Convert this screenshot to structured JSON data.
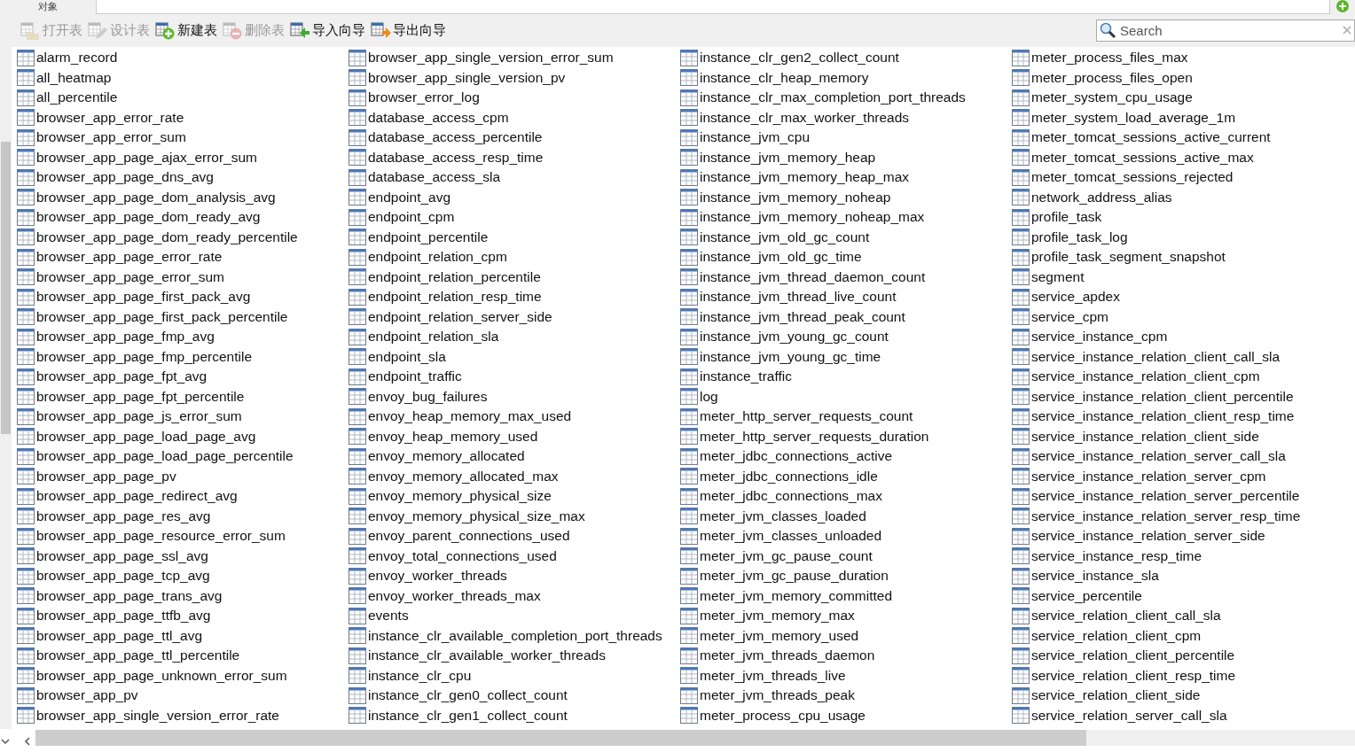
{
  "object_tab": {
    "label": "对象"
  },
  "toolbar": [
    {
      "label": "打开表",
      "kind": "open",
      "disabled": true
    },
    {
      "label": "设计表",
      "kind": "design",
      "disabled": true
    },
    {
      "label": "新建表",
      "kind": "new",
      "disabled": false
    },
    {
      "label": "删除表",
      "kind": "delete",
      "disabled": true
    },
    {
      "label": "导入向导",
      "kind": "import",
      "disabled": false
    },
    {
      "label": "导出向导",
      "kind": "export",
      "disabled": false
    }
  ],
  "search": {
    "placeholder": "Search"
  },
  "tables": [
    "alarm_record",
    "all_heatmap",
    "all_percentile",
    "browser_app_error_rate",
    "browser_app_error_sum",
    "browser_app_page_ajax_error_sum",
    "browser_app_page_dns_avg",
    "browser_app_page_dom_analysis_avg",
    "browser_app_page_dom_ready_avg",
    "browser_app_page_dom_ready_percentile",
    "browser_app_page_error_rate",
    "browser_app_page_error_sum",
    "browser_app_page_first_pack_avg",
    "browser_app_page_first_pack_percentile",
    "browser_app_page_fmp_avg",
    "browser_app_page_fmp_percentile",
    "browser_app_page_fpt_avg",
    "browser_app_page_fpt_percentile",
    "browser_app_page_js_error_sum",
    "browser_app_page_load_page_avg",
    "browser_app_page_load_page_percentile",
    "browser_app_page_pv",
    "browser_app_page_redirect_avg",
    "browser_app_page_res_avg",
    "browser_app_page_resource_error_sum",
    "browser_app_page_ssl_avg",
    "browser_app_page_tcp_avg",
    "browser_app_page_trans_avg",
    "browser_app_page_ttfb_avg",
    "browser_app_page_ttl_avg",
    "browser_app_page_ttl_percentile",
    "browser_app_page_unknown_error_sum",
    "browser_app_pv",
    "browser_app_single_version_error_rate",
    "browser_app_single_version_error_sum",
    "browser_app_single_version_pv",
    "browser_error_log",
    "database_access_cpm",
    "database_access_percentile",
    "database_access_resp_time",
    "database_access_sla",
    "endpoint_avg",
    "endpoint_cpm",
    "endpoint_percentile",
    "endpoint_relation_cpm",
    "endpoint_relation_percentile",
    "endpoint_relation_resp_time",
    "endpoint_relation_server_side",
    "endpoint_relation_sla",
    "endpoint_sla",
    "endpoint_traffic",
    "envoy_bug_failures",
    "envoy_heap_memory_max_used",
    "envoy_heap_memory_used",
    "envoy_memory_allocated",
    "envoy_memory_allocated_max",
    "envoy_memory_physical_size",
    "envoy_memory_physical_size_max",
    "envoy_parent_connections_used",
    "envoy_total_connections_used",
    "envoy_worker_threads",
    "envoy_worker_threads_max",
    "events",
    "instance_clr_available_completion_port_threads",
    "instance_clr_available_worker_threads",
    "instance_clr_cpu",
    "instance_clr_gen0_collect_count",
    "instance_clr_gen1_collect_count",
    "instance_clr_gen2_collect_count",
    "instance_clr_heap_memory",
    "instance_clr_max_completion_port_threads",
    "instance_clr_max_worker_threads",
    "instance_jvm_cpu",
    "instance_jvm_memory_heap",
    "instance_jvm_memory_heap_max",
    "instance_jvm_memory_noheap",
    "instance_jvm_memory_noheap_max",
    "instance_jvm_old_gc_count",
    "instance_jvm_old_gc_time",
    "instance_jvm_thread_daemon_count",
    "instance_jvm_thread_live_count",
    "instance_jvm_thread_peak_count",
    "instance_jvm_young_gc_count",
    "instance_jvm_young_gc_time",
    "instance_traffic",
    "log",
    "meter_http_server_requests_count",
    "meter_http_server_requests_duration",
    "meter_jdbc_connections_active",
    "meter_jdbc_connections_idle",
    "meter_jdbc_connections_max",
    "meter_jvm_classes_loaded",
    "meter_jvm_classes_unloaded",
    "meter_jvm_gc_pause_count",
    "meter_jvm_gc_pause_duration",
    "meter_jvm_memory_committed",
    "meter_jvm_memory_max",
    "meter_jvm_memory_used",
    "meter_jvm_threads_daemon",
    "meter_jvm_threads_live",
    "meter_jvm_threads_peak",
    "meter_process_cpu_usage",
    "meter_process_files_max",
    "meter_process_files_open",
    "meter_system_cpu_usage",
    "meter_system_load_average_1m",
    "meter_tomcat_sessions_active_current",
    "meter_tomcat_sessions_active_max",
    "meter_tomcat_sessions_rejected",
    "network_address_alias",
    "profile_task",
    "profile_task_log",
    "profile_task_segment_snapshot",
    "segment",
    "service_apdex",
    "service_cpm",
    "service_instance_cpm",
    "service_instance_relation_client_call_sla",
    "service_instance_relation_client_cpm",
    "service_instance_relation_client_percentile",
    "service_instance_relation_client_resp_time",
    "service_instance_relation_client_side",
    "service_instance_relation_server_call_sla",
    "service_instance_relation_server_cpm",
    "service_instance_relation_server_percentile",
    "service_instance_relation_server_resp_time",
    "service_instance_relation_server_side",
    "service_instance_resp_time",
    "service_instance_sla",
    "service_percentile",
    "service_relation_client_call_sla",
    "service_relation_client_cpm",
    "service_relation_client_percentile",
    "service_relation_client_resp_time",
    "service_relation_client_side",
    "service_relation_server_call_sla"
  ]
}
